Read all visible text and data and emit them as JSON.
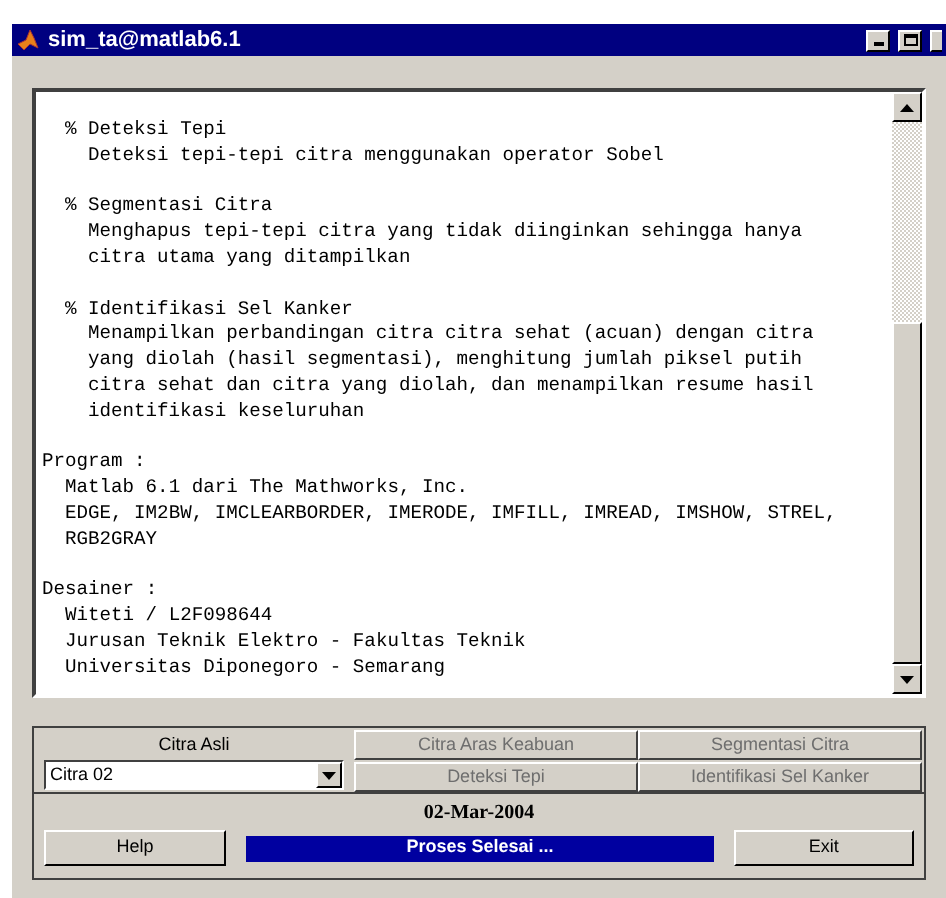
{
  "window": {
    "title": "sim_ta@matlab6.1"
  },
  "text_pane": {
    "blocks": [
      {
        "title": "% Deteksi Tepi",
        "lines": [
          "Deteksi tepi-tepi citra menggunakan operator Sobel"
        ]
      },
      {
        "title": "% Segmentasi Citra",
        "lines": [
          "Menghapus tepi-tepi citra yang tidak diinginkan sehingga hanya",
          "citra utama yang ditampilkan"
        ]
      },
      {
        "title": "% Identifikasi Sel Kanker",
        "lines": [
          "Menampilkan perbandingan citra citra sehat (acuan) dengan citra",
          "yang diolah (hasil segmentasi), menghitung jumlah piksel putih",
          "citra sehat dan citra yang diolah, dan menampilkan resume hasil",
          "identifikasi keseluruhan"
        ]
      }
    ],
    "sections": [
      {
        "title": "Program :",
        "lines": [
          "Matlab 6.1 dari The Mathworks, Inc.",
          "EDGE, IM2BW, IMCLEARBORDER, IMERODE, IMFILL, IMREAD, IMSHOW, STREL,",
          "RGB2GRAY"
        ]
      },
      {
        "title": "Desainer :",
        "lines": [
          "Witeti / L2F098644",
          "Jurusan Teknik Elektro - Fakultas Teknik",
          "Universitas Diponegoro - Semarang"
        ]
      }
    ]
  },
  "image_select": {
    "label": "Citra Asli",
    "value": "Citra 02"
  },
  "process_buttons": [
    {
      "label": "Citra Aras Keabuan",
      "disabled": true
    },
    {
      "label": "Segmentasi Citra",
      "disabled": true
    },
    {
      "label": "Deteksi Tepi",
      "disabled": true
    },
    {
      "label": "Identifikasi Sel Kanker",
      "disabled": true
    }
  ],
  "date": "02-Mar-2004",
  "help_button": "Help",
  "status": "Proses Selesai ...",
  "exit_button": "Exit"
}
